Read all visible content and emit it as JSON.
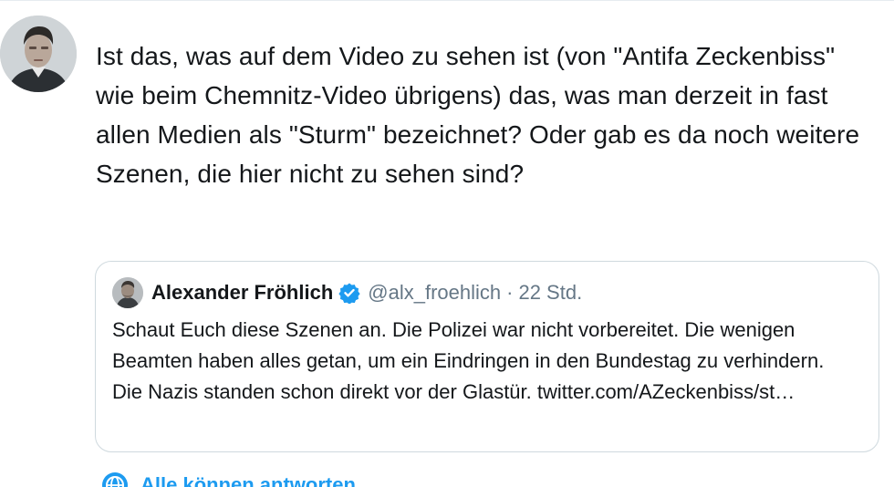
{
  "tweet": {
    "text": "Ist das, was auf dem Video zu sehen ist (von \"Antifa Zeckenbiss\" wie beim Chemnitz-Video übrigens) das, was man derzeit in fast allen Medien als \"Sturm\" bezeichnet? Oder gab es da noch weitere Szenen, die hier nicht zu sehen sind?"
  },
  "quote": {
    "author_name": "Alexander Fröhlich",
    "handle": "@alx_froehlich",
    "separator": "·",
    "time": "22 Std.",
    "text": "Schaut Euch diese Szenen an. Die Polizei war nicht vorbereitet. Die wenigen Beamten haben alles getan, um ein Eindringen in den Bundestag zu verhindern. Die Nazis standen schon direkt vor der Glastür. twitter.com/AZeckenbiss/st…"
  },
  "reply_settings": {
    "label": "Alle können antworten",
    "icon": "globe-icon"
  },
  "colors": {
    "accent": "#1d9bf0",
    "verified": "#1d9bf0",
    "secondary_text": "#657786",
    "border": "#cfd9de"
  }
}
